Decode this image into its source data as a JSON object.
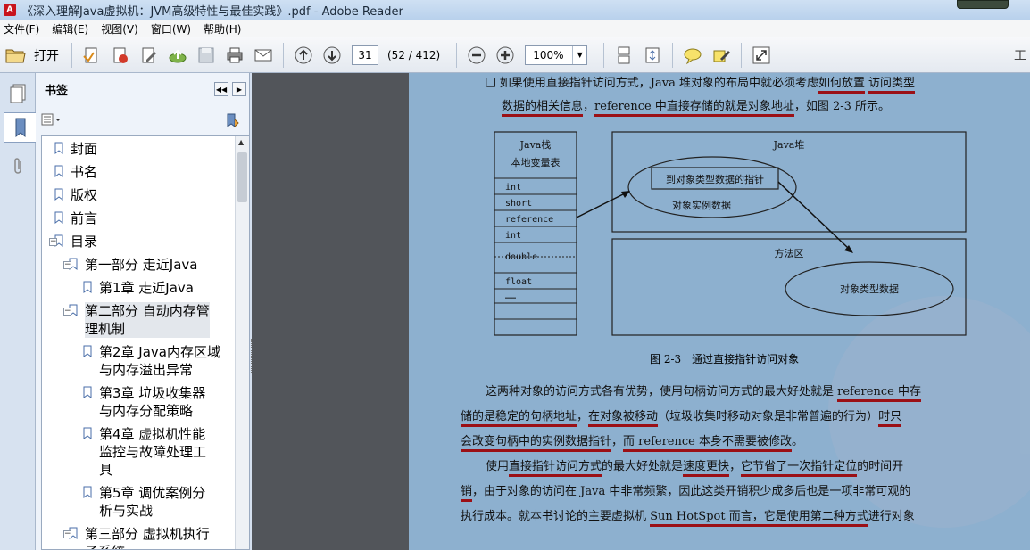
{
  "window": {
    "title": "《深入理解Java虚拟机：JVM高级特性与最佳实践》.pdf - Adobe Reader",
    "app_icon": "A"
  },
  "menu": [
    "文件(F)",
    "编辑(E)",
    "视图(V)",
    "窗口(W)",
    "帮助(H)"
  ],
  "toolbar": {
    "open_label": "打开",
    "page_number": "31",
    "page_count": "(52 / 412)",
    "zoom": "100%",
    "right_char": "工"
  },
  "panel": {
    "title": "书签",
    "bookmarks": [
      "封面",
      "书名",
      "版权",
      "前言",
      "目录",
      "第一部分 走近Java",
      "第1章 走近Java",
      "第二部分 自动内存管",
      "理机制",
      "第2章 Java内存区域",
      "与内存溢出异常",
      "第3章 垃圾收集器",
      "与内存分配策略",
      "第4章 虚拟机性能",
      "监控与故障处理工",
      "具",
      "第5章 调优案例分",
      "析与实战",
      "第三部分 虚拟机执行",
      "子系统"
    ]
  },
  "document": {
    "line1": [
      "❑ 如果使用直接指针访问方式，Java 堆对象的布局中就必须考虑",
      "如何放置",
      "访问类型"
    ],
    "line2": [
      "数据的相关信息",
      "，",
      "reference 中直接存储的就是对象地址",
      "，如图 2-3 所示。"
    ],
    "diagram": {
      "stack_title": "Java栈",
      "stack_subtitle": "本地变量表",
      "stack_rows": [
        "int",
        "short",
        "reference",
        "int",
        "double",
        "float",
        "……"
      ],
      "heap_title": "Java堆",
      "pointer_box": "到对象类型数据的指针",
      "instance_data": "对象实例数据",
      "method_area": "方法区",
      "type_data": "对象类型数据"
    },
    "caption": "图 2-3　通过直接指针访问对象",
    "p1_line1": [
      "这两种对象的访问方式各有优势，使用句柄访问方式的最大好处就是 ",
      "reference 中存"
    ],
    "p1_line2": [
      "储的是稳定的句柄地址",
      "，",
      "在对象被移动",
      "（垃圾收集时移动对象是非常普遍的行为）",
      "时只"
    ],
    "p1_line3": [
      "会改变",
      "句柄中的实例数据指针",
      "，",
      "而 reference 本身不需要被修改",
      "。"
    ],
    "p2_line1": [
      "使用",
      "直接指针访问方式",
      "的最大好处就是",
      "速度更快",
      "，",
      "它节省了一次",
      "指针定位",
      "的时间开"
    ],
    "p2_line2": [
      "销",
      "，由于对象的访问在 Java 中非常频繁，因此这类开销积少成多后也是一项非常可观的"
    ],
    "p2_line3": [
      "执行成本。就本书讨论的主要虚拟机 ",
      "Sun HotSpot 而言，它是使用第二种方式",
      "进行对象"
    ]
  },
  "colors": {
    "page_background": "#8db0cf",
    "underline": "#9b1016",
    "doc_area_background": "#52555a"
  }
}
